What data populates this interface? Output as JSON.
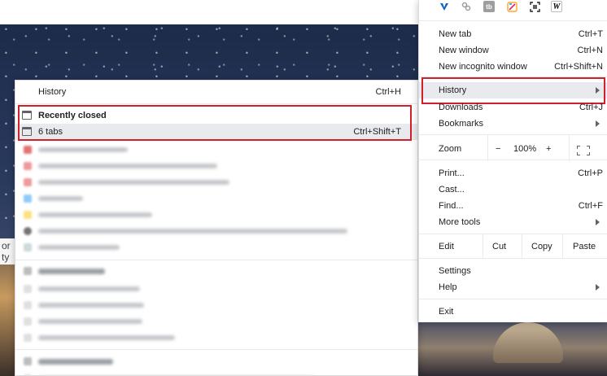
{
  "background": {
    "search_hint": "or ty"
  },
  "history_submenu": {
    "history_label": "History",
    "history_shortcut": "Ctrl+H",
    "recently_closed_label": "Recently closed",
    "tabs_label": "6 tabs",
    "tabs_shortcut": "Ctrl+Shift+T"
  },
  "menu": {
    "extensions": [
      "vivaldi-icon",
      "link-icon",
      "tb-icon",
      "edit-image-icon",
      "scan-icon",
      "w-icon"
    ],
    "extension_glyphs": [
      "V",
      "",
      "tb",
      "",
      "",
      "W"
    ],
    "new_tab": {
      "label": "New tab",
      "shortcut": "Ctrl+T"
    },
    "new_window": {
      "label": "New window",
      "shortcut": "Ctrl+N"
    },
    "new_incognito": {
      "label": "New incognito window",
      "shortcut": "Ctrl+Shift+N"
    },
    "history": {
      "label": "History"
    },
    "downloads": {
      "label": "Downloads",
      "shortcut": "Ctrl+J"
    },
    "bookmarks": {
      "label": "Bookmarks"
    },
    "zoom": {
      "label": "Zoom",
      "minus": "−",
      "value": "100%",
      "plus": "+"
    },
    "print": {
      "label": "Print...",
      "shortcut": "Ctrl+P"
    },
    "cast": {
      "label": "Cast..."
    },
    "find": {
      "label": "Find...",
      "shortcut": "Ctrl+F"
    },
    "more_tools": {
      "label": "More tools"
    },
    "edit": {
      "label": "Edit",
      "cut": "Cut",
      "copy": "Copy",
      "paste": "Paste"
    },
    "settings": {
      "label": "Settings"
    },
    "help": {
      "label": "Help"
    },
    "exit": {
      "label": "Exit"
    }
  },
  "colors": {
    "highlight": "#e8eaed",
    "annotation_red": "#d0202b"
  }
}
